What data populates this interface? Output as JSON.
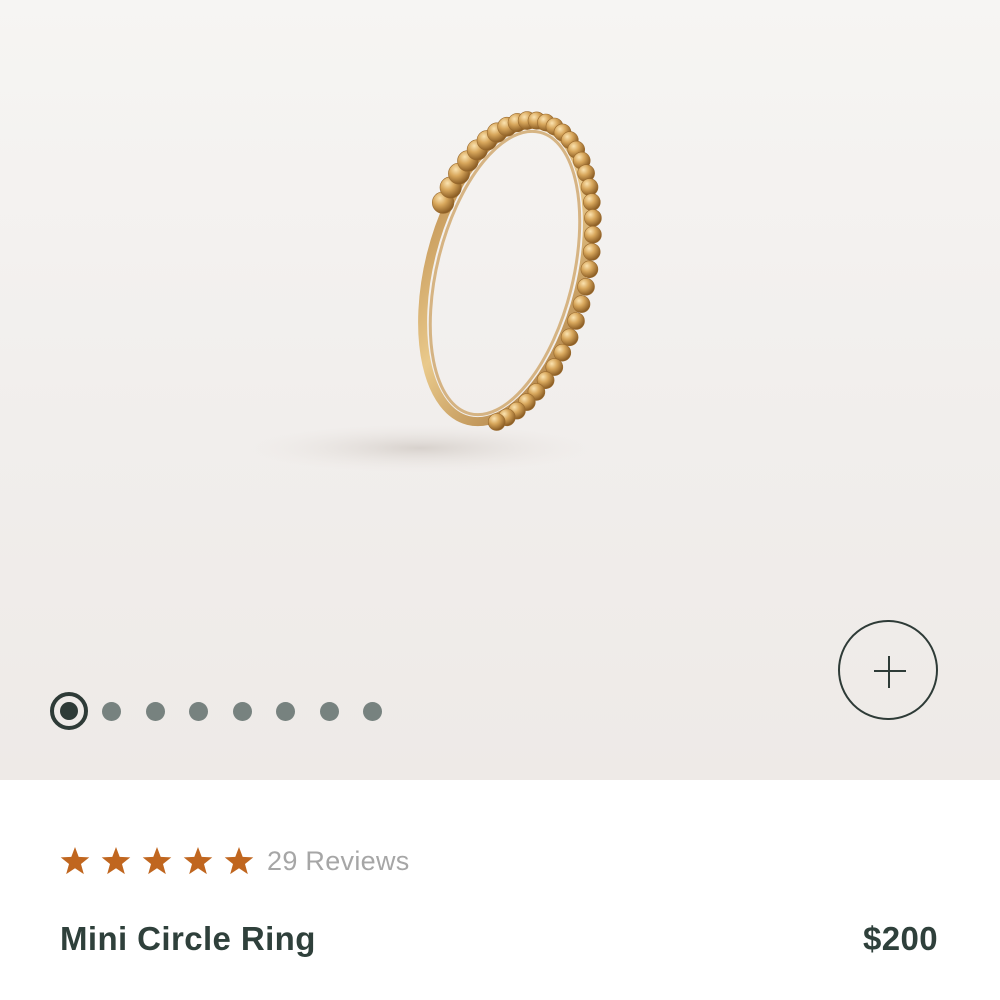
{
  "gallery": {
    "image_alt": "Mini Circle Ring",
    "total_images": 8,
    "active_index": 0,
    "zoom_icon": "plus-icon"
  },
  "product": {
    "rating": 5,
    "max_rating": 5,
    "reviews_label": "29 Reviews",
    "name": "Mini Circle Ring",
    "price": "$200"
  },
  "colors": {
    "accent": "#2e3b37",
    "star": "#c0661f",
    "dot_inactive": "#77827f",
    "text_muted": "#a6a6a6",
    "text_primary": "#2f403b",
    "ring_gold": "#d4a25a"
  }
}
